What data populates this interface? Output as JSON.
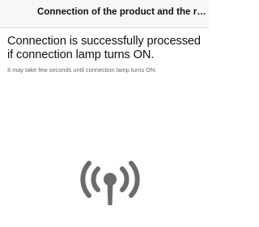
{
  "navbar": {
    "title": "Connection of the product and the ro..."
  },
  "content": {
    "headline": "Connection is successfully processed if connection lamp turns ON.",
    "subtext": "It may take few seconds until connection lamp turns ON."
  },
  "icons": {
    "signal": "wireless-signal-icon"
  },
  "colors": {
    "icon": "#6b6b6b",
    "navbar_bg": "#f7f7f7",
    "navbar_border": "#d9d9d9"
  }
}
